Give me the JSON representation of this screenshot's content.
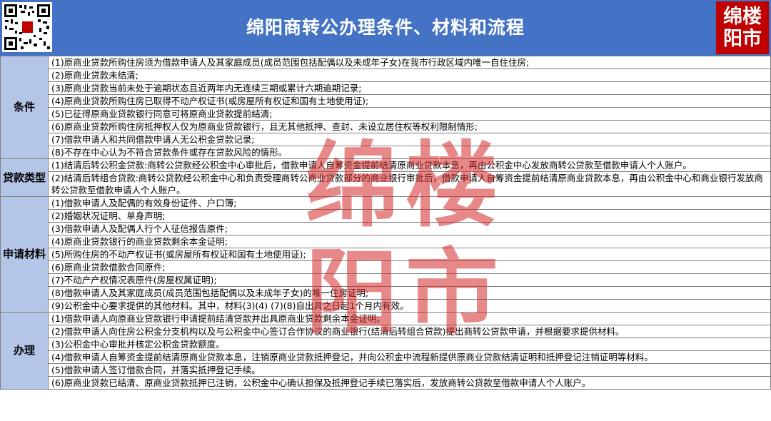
{
  "header": {
    "title": "绵阳商转公办理条件、材料和流程",
    "logo_line1": "绵楼",
    "logo_line2": "阳市"
  },
  "sections": [
    {
      "label": "条件",
      "items": [
        "(1)原商业贷款所购住房须为借款申请人及其家庭成员(成员范围包括配偶以及未成年子女)在我市行政区域内唯一自住住房;",
        "(2)原商业贷款未结清;",
        "(3)原商业贷款当前未处于逾期状态且近两年内无连续三期或累计六期逾期记录;",
        "(4)原商业贷款所购住房已取得不动产权证书(或房屋所有权证和国有土地使用证);",
        "(5)已征得原商业贷款银行同意可将原商业贷款提前结清;",
        "(6)原商业贷款所购住房抵押权人仅为原商业贷款银行，且无其他抵押、查封、未设立居住权等权利限制情形;",
        "(7)借款申请人和共同借款申请人无公积金贷款记录;",
        "(8)不存在中心认为不符合贷款条件或存在贷款风险的情形。"
      ]
    },
    {
      "label": "贷款类型",
      "items": [
        "(1)结清后转公积金贷款:商转公贷款经公积金中心审批后，借款申请人自筹资金提前结清原商业贷款本息，再由公积金中心发放商转公贷款至借款申请人个人账户。",
        "(2)结清后转组合贷款:商转公贷款经公积金中心和负责受理商转公商业贷款部分的商业银行审批后，借款申请人自筹资金提前结清原商业贷款本息，再由公积金中心和商业银行发放商转公贷款至借款申请人个人账户。"
      ]
    },
    {
      "label": "申请材料",
      "items": [
        "(1)借款申请人及配偶的有效身份证件、户口簿;",
        "(2)婚姻状况证明、单身声明;",
        "(3)借款申请人及配偶人行个人征信报告原件;",
        "(4)原商业贷款银行的商业贷款剩余本金证明;",
        "(5)所购住房的不动产权证书(或房屋所有权证和国有土地使用证);",
        "(6)原商业贷款借款合同原件;",
        "(7)不动产产权情况表原件(房屋权属证明);",
        "(8)借款申请人及其家庭成员(成员范围包括配偶以及未成年子女)的唯一住房证明;",
        "(9)公积金中心要求提供的其他材料。其中，材料(3)(4) (7)(8)自出具之日起1个月内有效。"
      ]
    },
    {
      "label": "办理",
      "items": [
        "(1)借款申请人向原商业贷款银行申请提前结清贷款并出具原商业贷款剩余本金证明。",
        "(2)借款申请人向住房公积金分支机构以及与公积金中心签订合作协议的商业银行(结清后转组合贷款)提出商转公贷款申请，并根据要求提供材料。",
        "(3)公积金中心审批并核定公积金贷款额度。",
        "(4)借款申请人自筹资金提前结清原商业贷款本息，注销原商业贷款抵押登记，并向公积金中流程新提供原商业贷款结清证明和抵押登记注销证明等材料。",
        "(5)借款申请人签订借款合同，并落实抵押登记手续。",
        "(6)原商业贷款已结清、原商业贷款抵押已注销，公积金中心确认担保及抵押登记手续已落实后，发放商转公贷款至借款申请人个人账户。"
      ]
    }
  ],
  "watermark": {
    "chars": [
      "绵",
      "楼",
      "阳",
      "市"
    ],
    "color": "#d62828"
  }
}
